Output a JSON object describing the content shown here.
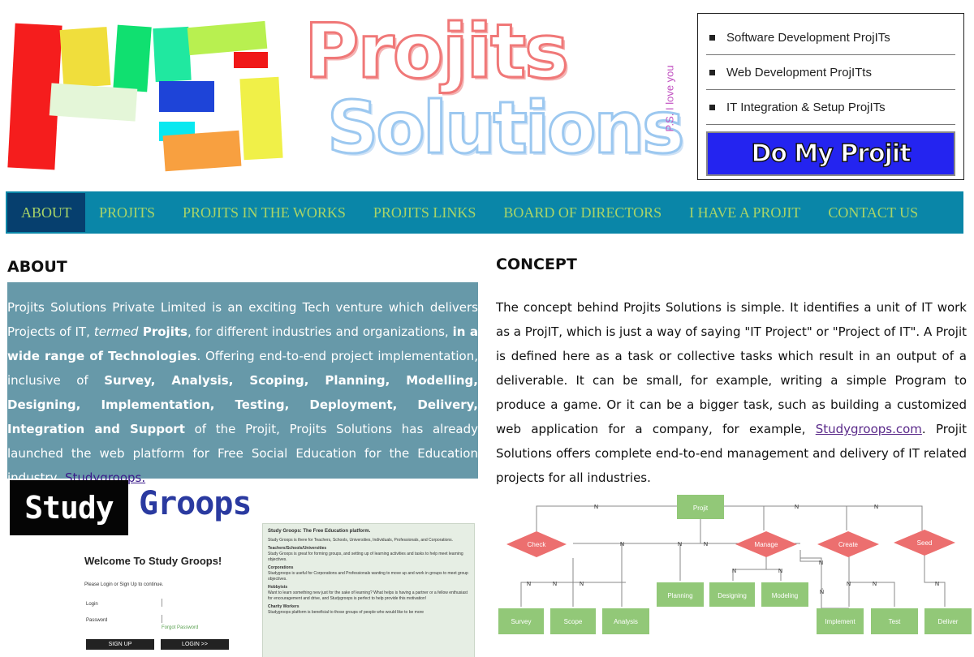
{
  "header": {
    "wordmark_line1": "Projits",
    "wordmark_line2": "Solutions",
    "tagline": "P.S. I love you",
    "menu": [
      {
        "label": "Software Development ProjITs"
      },
      {
        "label": "Web Development ProjITts"
      },
      {
        "label": "IT Integration & Setup ProjITs"
      }
    ],
    "cta_label": "Do My Projit"
  },
  "nav": {
    "items": [
      {
        "label": "ABOUT",
        "active": true
      },
      {
        "label": "PROJITS"
      },
      {
        "label": "PROJITS IN THE WORKS"
      },
      {
        "label": "PROJITS LINKS"
      },
      {
        "label": "BOARD OF DIRECTORS"
      },
      {
        "label": "I HAVE A PROJIT"
      },
      {
        "label": "CONTACT US"
      }
    ]
  },
  "about": {
    "title": "ABOUT",
    "p1": "Projits Solutions Private Limited is an exciting Tech venture which delivers Projects of IT, ",
    "termed": "termed",
    "projits": " Projits",
    "p2": ", for different industries and organizations, ",
    "range": "in a wide range of Technologies",
    "p3": ". Offering end-to-end project implementation, inclusive of ",
    "services": "Survey, Analysis, Scoping, Planning, Modelling, Designing, Implementation, Testing, Deployment, Delivery, Integration and Support",
    "p4": " of the Projit, Projits Solutions has already launched the web platform for Free Social Education for the Education industry, ",
    "link": "Studygroops."
  },
  "concept": {
    "title": "CONCEPT",
    "p1": "The concept behind Projits Solutions is simple. It identifies a unit of IT work as a ProjIT, which is just a way of saying \"IT Project\" or \"Project of IT\". A Projit is defined here as a task or collective tasks which result in an output of a deliverable. It can be small, for example, writing a simple Program to produce a game. Or it can be a bigger task, such as building a customized web application for a company, for example, ",
    "link": "Studygroops.com",
    "p2": ". Projit Solutions offers complete end-to-end management and delivery of IT related projects for all industries."
  },
  "studygroops": {
    "logo_left": "Study",
    "logo_right": "Groops",
    "welcome": "Welcome To Study Groops!",
    "prompt": "Please Login or Sign Up to continue.",
    "login_label": "Login",
    "password_label": "Password",
    "forgot": "Forgot Password",
    "signup_btn": "SIGN UP",
    "login_btn": "LOGIN >>",
    "panel_title": "Study Groops: The Free Education platform.",
    "panel_intro": "Study Groops is there for Teachers, Schools, Universities, Individuals, Professionals, and Corporations.",
    "panel_sections": [
      {
        "heading": "Teachers/Schools/Universities",
        "text": "Study Groops is great for forming groups, and setting up of learning activities and tasks to help meet learning objectives."
      },
      {
        "heading": "Corporations",
        "text": "Studygroops is useful for Corporations and Professionals wanting to move up and work in groups to meet group objectives."
      },
      {
        "heading": "Hobbyists",
        "text": "Want to learn something new just for the sake of learning? What helps is having a partner or a fellow enthusiast for encouragement and drive, and Studygroops is perfect to help provide this motivation!"
      },
      {
        "heading": "Charity Workers",
        "text": "Studygroops platform is beneficial to those groups of people who would like to be more"
      }
    ]
  },
  "diagram": {
    "root": "Projit",
    "decisions": [
      "Check",
      "Manage",
      "Create",
      "Seed"
    ],
    "tasks": [
      "Survey",
      "Scope",
      "Analysis",
      "Planning",
      "Designing",
      "Modeling",
      "Implement",
      "Test",
      "Deliver"
    ],
    "edge_label": "N"
  },
  "colors": {
    "nav_bg": "#0a86a8",
    "nav_active": "#063f6e",
    "nav_text": "#a8d468",
    "about_bg": "#6799a9",
    "diamond": "#ec6f6f",
    "task_box": "#92c878",
    "cta_bg": "#2424f0"
  }
}
